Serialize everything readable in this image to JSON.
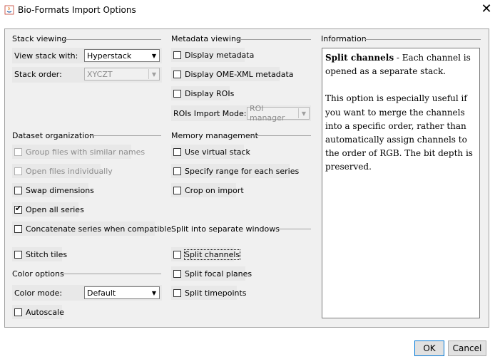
{
  "window": {
    "title": "Bio-Formats Import Options",
    "close_symbol": "✕"
  },
  "stack_viewing": {
    "header": "Stack viewing",
    "view_stack_label": "View stack with:",
    "view_stack_value": "Hyperstack",
    "stack_order_label": "Stack order:",
    "stack_order_value": "XYCZT"
  },
  "metadata_viewing": {
    "header": "Metadata viewing",
    "display_metadata": "Display metadata",
    "display_omexml": "Display OME-XML metadata",
    "display_rois": "Display ROIs",
    "rois_mode_label": "ROIs Import Mode:",
    "rois_mode_value": "ROI manager"
  },
  "dataset_organization": {
    "header": "Dataset organization",
    "group_files": "Group files with similar names",
    "open_individually": "Open files individually",
    "swap_dimensions": "Swap dimensions",
    "open_all_series": "Open all series",
    "concatenate": "Concatenate series when compatible",
    "stitch_tiles": "Stitch tiles"
  },
  "memory_management": {
    "header": "Memory management",
    "virtual_stack": "Use virtual stack",
    "specify_range": "Specify range for each series",
    "crop_on_import": "Crop on import"
  },
  "split_windows": {
    "header": "Split into separate windows",
    "split_channels": "Split channels",
    "split_focal": "Split focal planes",
    "split_timepoints": "Split timepoints"
  },
  "color_options": {
    "header": "Color options",
    "color_mode_label": "Color mode:",
    "color_mode_value": "Default",
    "autoscale": "Autoscale"
  },
  "information": {
    "header": "Information",
    "bold_term": "Split channels",
    "line1_rest": " - Each channel is opened as a separate stack.",
    "paragraph2": "This option is especially useful if you want to merge the channels into a specific order, rather than automatically assign channels to the order of RGB. The bit depth is preserved."
  },
  "buttons": {
    "ok": "OK",
    "cancel": "Cancel"
  },
  "checked": {
    "open_all_series": "✔"
  }
}
